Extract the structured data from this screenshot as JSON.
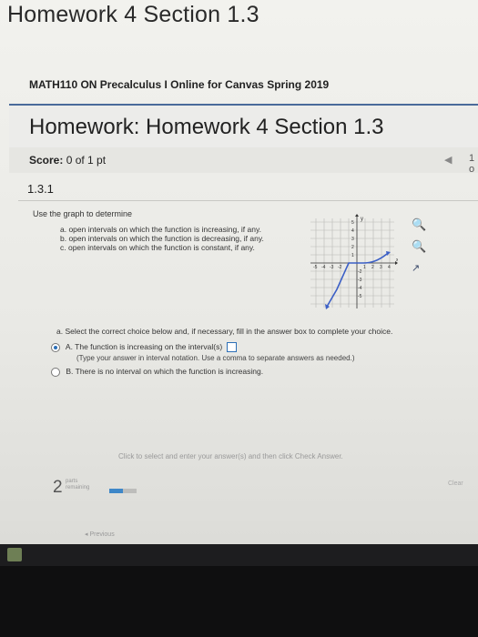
{
  "window": {
    "title": "Homework 4 Section 1.3"
  },
  "course": {
    "name": "MATH110 ON Precalculus I Online for Canvas Spring 2019"
  },
  "header": {
    "title": "Homework: Homework 4 Section 1.3"
  },
  "score": {
    "label": "Score:",
    "value": "0 of 1 pt"
  },
  "nav": {
    "index": "1 o"
  },
  "question": {
    "number": "1.3.1",
    "prompt": "Use the graph to determine",
    "items": [
      "a. open intervals on which the function is increasing, if any.",
      "b. open intervals on which the function is decreasing, if any.",
      "c. open intervals on which the function is constant, if any."
    ],
    "instruction": "a. Select the correct choice below and, if necessary, fill in the answer box to complete your choice.",
    "choices": [
      {
        "label": "A.",
        "text": "The function is increasing on the interval(s)",
        "selected": true
      },
      {
        "label": "B.",
        "text": "There is no interval on which the function is increasing.",
        "selected": false
      }
    ],
    "hint": "(Type your answer in interval notation. Use a comma to separate answers as needed.)"
  },
  "graph": {
    "x_tick_labels": [
      "-5",
      "-4",
      "-3",
      "-2",
      "1",
      "2",
      "3",
      "4"
    ],
    "y_tick_labels": [
      "5",
      "4",
      "3",
      "2",
      "1",
      "-2",
      "-3",
      "-4",
      "-5"
    ],
    "axis_label_y": "y",
    "axis_label_x": "x"
  },
  "footer": {
    "message": "Click to select and enter your answer(s) and then click Check Answer.",
    "parts_count": "2",
    "parts_label_1": "parts",
    "parts_label_2": "remaining",
    "progress": 0.5,
    "clear_label": "Clear",
    "previous_label": "◂ Previous"
  },
  "colors": {
    "accent": "#3e87c8",
    "header_rule": "#4a6a9a",
    "taskbar": "#0f0f10"
  }
}
